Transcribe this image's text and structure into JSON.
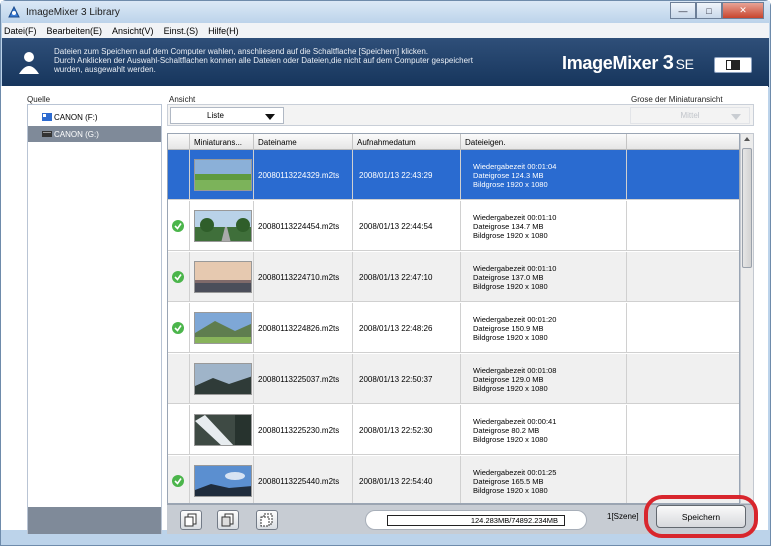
{
  "window": {
    "title": "ImageMixer 3 Library",
    "buttons": {
      "minimize": "—",
      "maximize": "□",
      "close": "✕"
    }
  },
  "menu": [
    "Datei(F)",
    "Bearbeiten(E)",
    "Ansicht(V)",
    "Einst.(S)",
    "Hilfe(H)"
  ],
  "banner": {
    "message_line1": "Dateien zum Speichern auf dem Computer wahlen, anschliesend auf die Schaltflache [Speichern] klicken.",
    "message_line2": "Durch Anklicken der Auswahl-Schaltflachen konnen alle Dateien oder Dateien,die nicht auf dem Computer gespeichert",
    "message_line3": "wurden, ausgewahlt werden.",
    "brand": "ImageMixer",
    "brand_version": "3",
    "brand_edition": "SE"
  },
  "labels": {
    "quelle": "Quelle",
    "ansicht": "Ansicht",
    "thumb_size": "Grose der Miniaturansicht"
  },
  "sources": [
    {
      "label": "CANON (F:)",
      "selected": false
    },
    {
      "label": "CANON (G:)",
      "selected": true
    }
  ],
  "view_select": "Liste",
  "thumb_select": "Mittel",
  "table": {
    "headers": [
      "Miniaturans...",
      "Dateiname",
      "Aufnahmedatum",
      "Dateieigen."
    ],
    "rows": [
      {
        "checked": false,
        "filename": "20080113224329.m2ts",
        "date": "2008/01/13 22:43:29",
        "duration": "Wiedergabezeit 00:01:04",
        "size": "Dateigrose 124.3 MB",
        "res": "Bildgrose 1920 x 1080",
        "thumb": "grass-field"
      },
      {
        "checked": true,
        "filename": "20080113224454.m2ts",
        "date": "2008/01/13 22:44:54",
        "duration": "Wiedergabezeit 00:01:10",
        "size": "Dateigrose 134.7 MB",
        "res": "Bildgrose 1920 x 1080",
        "thumb": "tree-road"
      },
      {
        "checked": true,
        "filename": "20080113224710.m2ts",
        "date": "2008/01/13 22:47:10",
        "duration": "Wiedergabezeit 00:01:10",
        "size": "Dateigrose 137.0 MB",
        "res": "Bildgrose 1920 x 1080",
        "thumb": "sunset-sea"
      },
      {
        "checked": true,
        "filename": "20080113224826.m2ts",
        "date": "2008/01/13 22:48:26",
        "duration": "Wiedergabezeit 00:01:20",
        "size": "Dateigrose 150.9 MB",
        "res": "Bildgrose 1920 x 1080",
        "thumb": "mountain-meadow"
      },
      {
        "checked": false,
        "filename": "20080113225037.m2ts",
        "date": "2008/01/13 22:50:37",
        "duration": "Wiedergabezeit 00:01:08",
        "size": "Dateigrose 129.0 MB",
        "res": "Bildgrose 1920 x 1080",
        "thumb": "dark-hills"
      },
      {
        "checked": false,
        "filename": "20080113225230.m2ts",
        "date": "2008/01/13 22:52:30",
        "duration": "Wiedergabezeit 00:00:41",
        "size": "Dateigrose 80.2 MB",
        "res": "Bildgrose 1920 x 1080",
        "thumb": "waterfall"
      },
      {
        "checked": true,
        "filename": "20080113225440.m2ts",
        "date": "2008/01/13 22:54:40",
        "duration": "Wiedergabezeit 00:01:25",
        "size": "Dateigrose 165.5 MB",
        "res": "Bildgrose 1920 x 1080",
        "thumb": "blue-sky-hill"
      }
    ]
  },
  "footer": {
    "storage": "124.283MB/74892.234MB",
    "scene": "1[Szene]",
    "save_label": "Speichern"
  },
  "colors": {
    "banner": "#1e3f69",
    "selected_row": "#2a6bd0",
    "check": "#4bb54b",
    "highlight_ring": "#d8262d"
  }
}
